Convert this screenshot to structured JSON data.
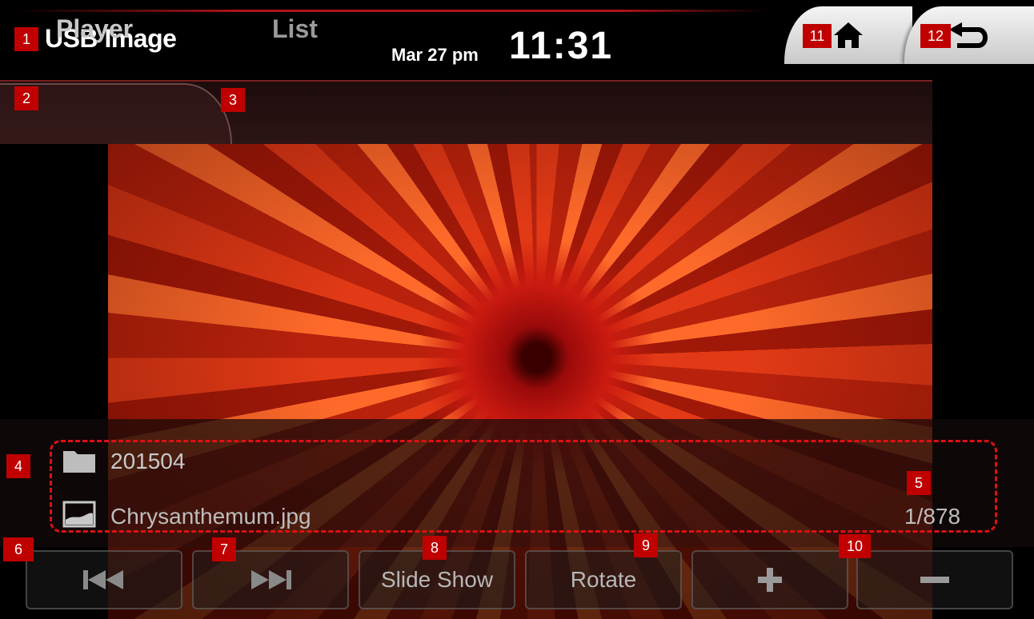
{
  "header": {
    "app_title": "USB Image",
    "date": "Mar 27 pm",
    "time": "11:31",
    "home_icon": "home-icon",
    "back_icon": "back-arrow-icon"
  },
  "tabs": [
    {
      "label": "Player",
      "active": true
    },
    {
      "label": "List",
      "active": false
    }
  ],
  "image": {
    "icon": "photo-chrysanthemum"
  },
  "info": {
    "folder_icon": "folder-icon",
    "folder": "201504",
    "file_icon": "image-file-icon",
    "file": "Chrysanthemum.jpg",
    "counter": "1/878"
  },
  "controls": [
    {
      "name": "previous",
      "icon": "skip-previous-icon",
      "label": ""
    },
    {
      "name": "next",
      "icon": "skip-next-icon",
      "label": ""
    },
    {
      "name": "slideshow",
      "label": "Slide Show"
    },
    {
      "name": "rotate",
      "label": "Rotate"
    },
    {
      "name": "zoom-in",
      "icon": "plus-icon",
      "label": ""
    },
    {
      "name": "zoom-out",
      "icon": "minus-icon",
      "label": ""
    }
  ],
  "badges": [
    "1",
    "2",
    "3",
    "4",
    "5",
    "6",
    "7",
    "8",
    "9",
    "10",
    "11",
    "12"
  ],
  "colors": {
    "badge": "#c00000",
    "annotation_dashes": "#d11111",
    "header_bg": "#000000"
  }
}
